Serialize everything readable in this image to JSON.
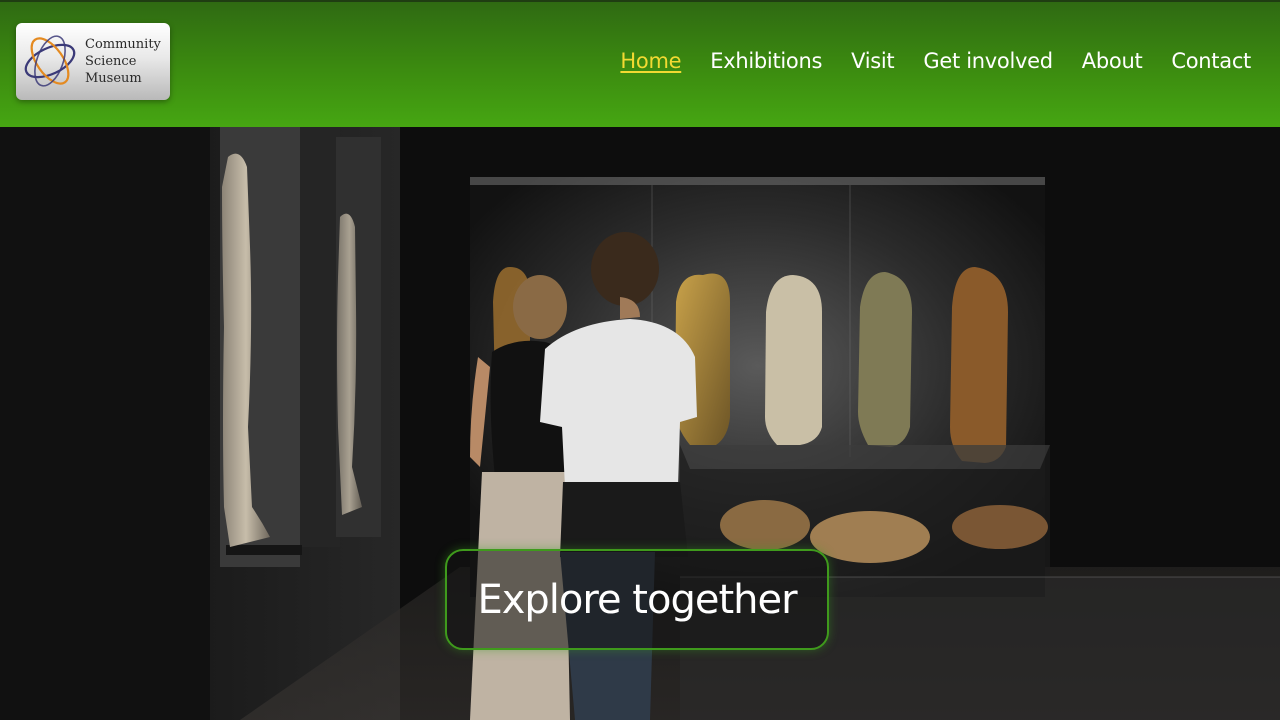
{
  "logo": {
    "lines": [
      "Community",
      "Science",
      "Museum"
    ],
    "colors": {
      "orbit_orange": "#e48a20",
      "orbit_purple": "#3b3a78"
    }
  },
  "nav": {
    "items": [
      {
        "label": "Home",
        "active": true
      },
      {
        "label": "Exhibitions",
        "active": false
      },
      {
        "label": "Visit",
        "active": false
      },
      {
        "label": "Get involved",
        "active": false
      },
      {
        "label": "About",
        "active": false
      },
      {
        "label": "Contact",
        "active": false
      }
    ],
    "active_color": "#f2da32"
  },
  "hero": {
    "cta_label": "Explore together"
  },
  "colors": {
    "header_green": "#3c8c10",
    "cta_border": "#3f9a1c"
  }
}
